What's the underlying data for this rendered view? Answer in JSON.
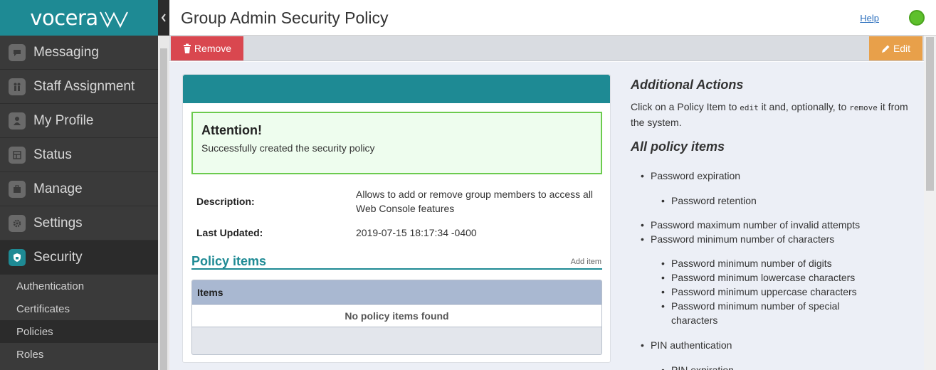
{
  "app": {
    "logo_text": "vocera",
    "brand_color": "#1e8a94"
  },
  "sidebar": {
    "items": [
      {
        "label": "Messaging",
        "icon": "chat-bubble-icon"
      },
      {
        "label": "Staff Assignment",
        "icon": "people-icon"
      },
      {
        "label": "My Profile",
        "icon": "person-icon"
      },
      {
        "label": "Status",
        "icon": "status-icon"
      },
      {
        "label": "Manage",
        "icon": "briefcase-icon"
      },
      {
        "label": "Settings",
        "icon": "gear-icon"
      },
      {
        "label": "Security",
        "icon": "shield-icon",
        "active": true
      }
    ],
    "subitems": [
      {
        "label": "Authentication"
      },
      {
        "label": "Certificates"
      },
      {
        "label": "Policies",
        "active": true
      },
      {
        "label": "Roles"
      }
    ]
  },
  "header": {
    "title": "Group Admin Security Policy",
    "help": "Help",
    "status_color": "#5ec02c"
  },
  "toolbar": {
    "remove_label": "Remove",
    "edit_label": "Edit"
  },
  "alert": {
    "title": "Attention!",
    "message": "Successfully created the security policy"
  },
  "details": {
    "description_label": "Description:",
    "description_value": "Allows to add or remove group members to access all Web Console features",
    "updated_label": "Last Updated:",
    "updated_value": "2019-07-15 18:17:34 -0400"
  },
  "policy_items": {
    "title": "Policy items",
    "add_label": "Add item",
    "column": "Items",
    "empty": "No policy items found"
  },
  "right": {
    "actions_title": "Additional Actions",
    "actions_text_1": "Click on a Policy Item to ",
    "actions_code_edit": "edit",
    "actions_text_2": " it and, optionally, to ",
    "actions_code_remove": "remove",
    "actions_text_3": " it from the system.",
    "all_title": "All policy items",
    "list": [
      {
        "label": "Password expiration",
        "level": 1
      },
      {
        "label": "Password retention",
        "level": 2
      },
      {
        "label": "Password maximum number of invalid attempts",
        "level": 1
      },
      {
        "label": "Password minimum number of characters",
        "level": 1
      },
      {
        "label": "Password minimum number of digits",
        "level": 2
      },
      {
        "label": "Password minimum lowercase characters",
        "level": 2
      },
      {
        "label": "Password minimum uppercase characters",
        "level": 2
      },
      {
        "label": "Password minimum number of special characters",
        "level": 2
      },
      {
        "label": "PIN authentication",
        "level": 1
      },
      {
        "label": "PIN expiration",
        "level": 2
      }
    ]
  }
}
